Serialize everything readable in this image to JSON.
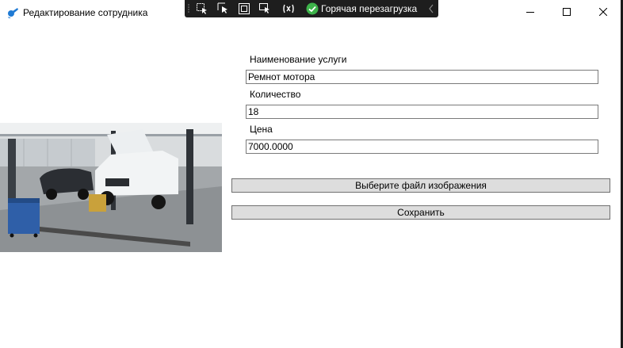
{
  "window": {
    "title": "Редактирование сотрудника",
    "app_icon": "app-icon",
    "controls": [
      "minimize-icon",
      "maximize-icon",
      "close-icon"
    ]
  },
  "dev_toolbar": {
    "tools": [
      "select-element-icon",
      "selection-adorner-icon",
      "layout-adorners-icon",
      "track-focus-icon",
      "display-layout-icon"
    ],
    "hot_reload_icon": "checkmark-circle-icon",
    "hot_reload_label": "Горячая перезагрузка",
    "collapse_icon": "chevron-left-icon"
  },
  "form": {
    "service_name_label": "Наименование услуги",
    "service_name_value": "Ремнот мотора",
    "quantity_label": "Количество",
    "quantity_value": "18",
    "price_label": "Цена",
    "price_value": "7000.0000",
    "choose_image_button": "Выберите файл изображения",
    "save_button": "Сохранить"
  },
  "image": {
    "subject": "car-service-lift-photo"
  },
  "colors": {
    "devbar_bg": "#1e1e1e",
    "hot_reload_green": "#3db34a",
    "button_bg": "#dddddd",
    "button_border": "#707070",
    "field_border": "#7a7a7a"
  }
}
